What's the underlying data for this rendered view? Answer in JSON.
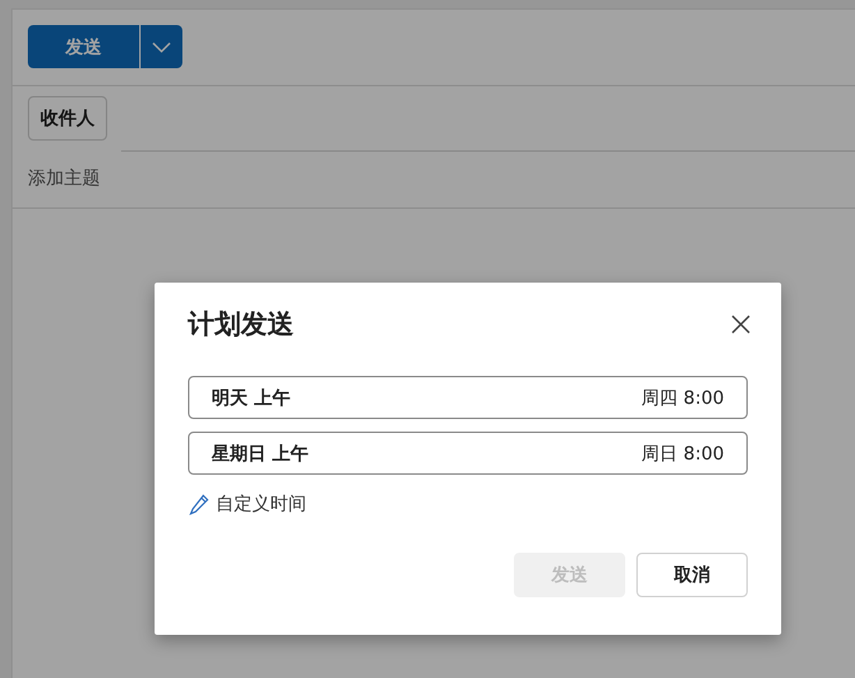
{
  "compose": {
    "send_button": "发送",
    "recipients_button": "收件人",
    "subject": {
      "placeholder": "添加主题"
    }
  },
  "dialog": {
    "title": "计划发送",
    "options": [
      {
        "label": "明天 上午",
        "time": "周四 8:00"
      },
      {
        "label": "星期日 上午",
        "time": "周日 8:00"
      }
    ],
    "custom_time": "自定义时间",
    "buttons": [
      {
        "label": "发送",
        "disabled": true
      },
      {
        "label": "取消",
        "disabled": false
      }
    ]
  }
}
